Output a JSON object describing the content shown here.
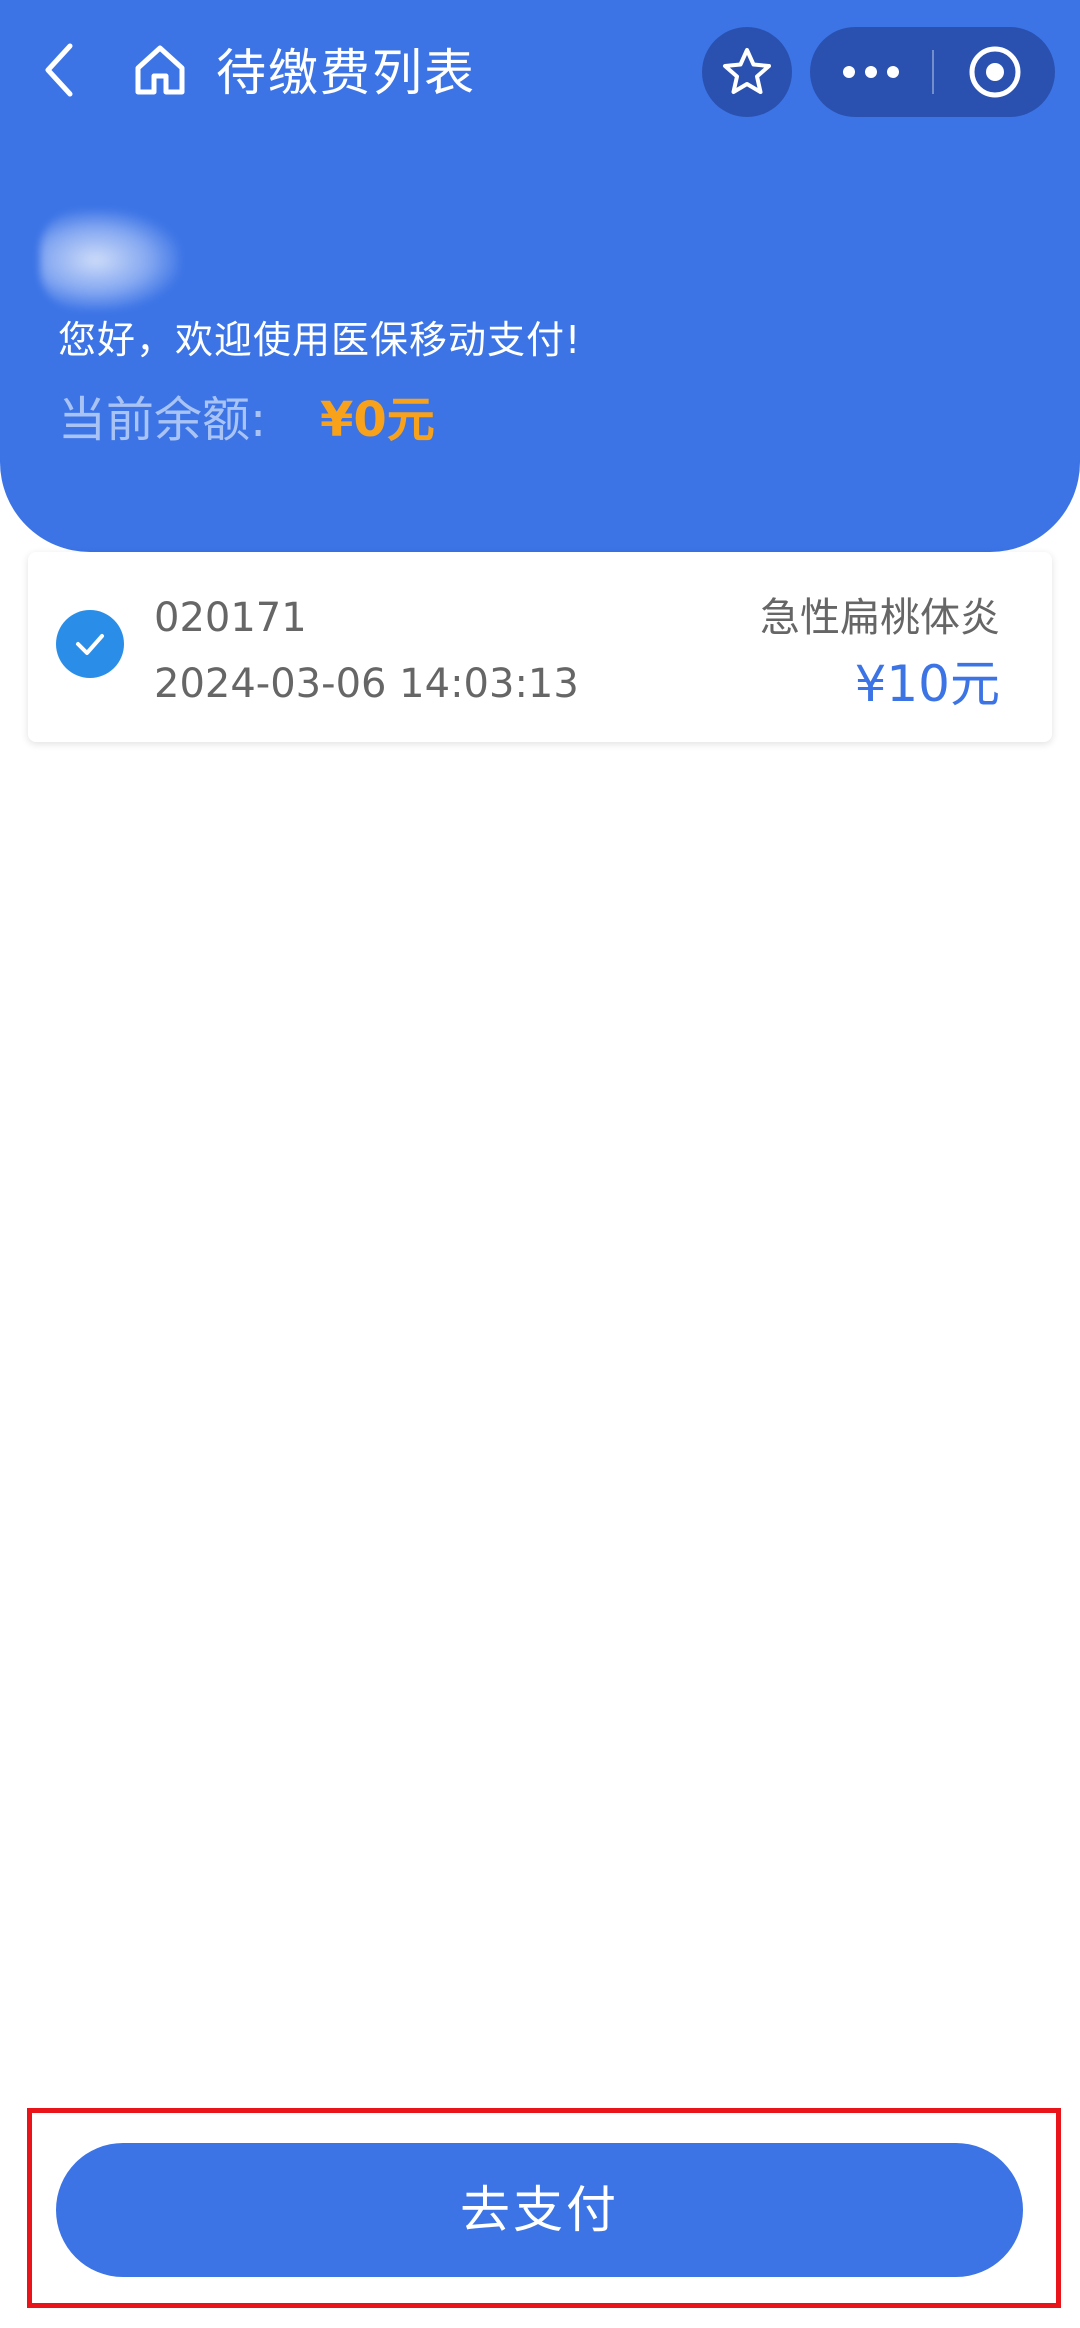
{
  "theme": {
    "primary": "#3c74e6",
    "accent": "#f8a21b",
    "checkbox_color": "#2a8ee9",
    "highlight_color": "#e8141a"
  },
  "nav": {
    "title": "待缴费列表",
    "back_icon": "chevron-left-icon",
    "home_icon": "home-icon",
    "star_icon": "star-icon",
    "more_icon": "more-dots-icon",
    "close_icon": "target-circle-icon"
  },
  "header": {
    "greeting": "您好，欢迎使用医保移动支付!",
    "balance_label": "当前余额:",
    "balance_value": "¥0元"
  },
  "items": [
    {
      "code": "020171",
      "datetime": "2024-03-06 14:03:13",
      "name": "急性扁桃体炎",
      "amount": "¥10元",
      "checked": true
    }
  ],
  "footer": {
    "pay_label": "去支付"
  }
}
